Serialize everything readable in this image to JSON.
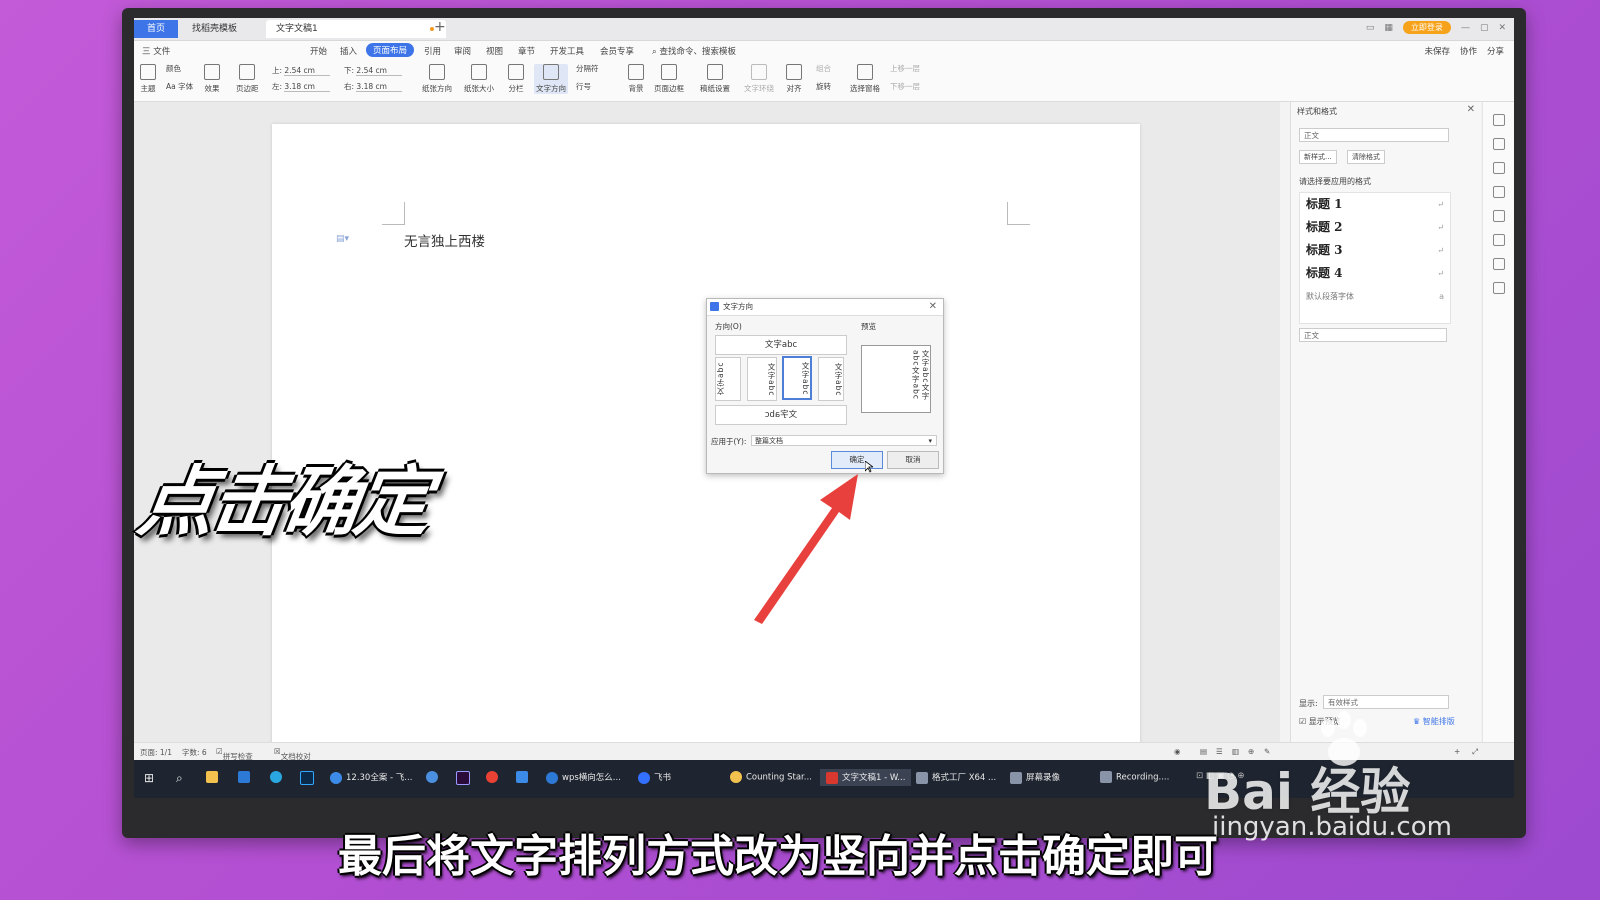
{
  "titlebar": {
    "tabs": [
      {
        "label": "首页"
      },
      {
        "label": "找稻壳模板"
      },
      {
        "label": "文字文稿1"
      }
    ],
    "new_tab": "+",
    "login": "立即登录"
  },
  "menubar": {
    "file": "三 文件",
    "items": [
      "开始",
      "插入",
      "页面布局",
      "引用",
      "审阅",
      "视图",
      "章节",
      "开发工具",
      "会员专享"
    ],
    "search": "查找命令、搜索模板",
    "unsaved": "未保存",
    "collab": "协作",
    "share": "分享"
  },
  "ribbon": {
    "theme": "主题",
    "colors": "颜色",
    "fonts": "Aa 字体",
    "effects": "效果",
    "margins": "页边距",
    "top_label": "上:",
    "top_val": "2.54 cm",
    "bottom_label": "下:",
    "bottom_val": "2.54 cm",
    "left_label": "左:",
    "left_val": "3.18 cm",
    "right_label": "右:",
    "right_val": "3.18 cm",
    "orientation": "纸张方向",
    "size": "纸张大小",
    "columns": "分栏",
    "text_dir": "文字方向",
    "breaks": "分隔符",
    "line_num": "行号",
    "background": "背景",
    "border": "页面边框",
    "paper_setup": "稿纸设置",
    "wrap": "文字环绕",
    "align": "对齐",
    "rotate": "旋转",
    "group": "组合",
    "select_pane": "选择窗格",
    "bring_fwd": "上移一层",
    "send_back": "下移一层"
  },
  "document": {
    "text": "无言独上西楼"
  },
  "dialog": {
    "title": "文字方向",
    "direction_label": "方向(O)",
    "preview_label": "预览",
    "opt_horizontal": "文字abc",
    "opt_v1": "文字abc",
    "opt_v2": "文字abc",
    "opt_v3": "文字abc",
    "opt_v4": "文字abc",
    "opt_rotated": "文字abc",
    "preview_text": "文字abc文字abc文字abc",
    "apply_label": "应用于(Y):",
    "apply_value": "整篇文档",
    "ok": "确定",
    "cancel": "取消"
  },
  "pane": {
    "title": "样式和格式",
    "current": "正文",
    "new_style": "新样式...",
    "clear_format": "清除格式",
    "choose_label": "请选择要应用的格式",
    "styles": [
      "标题 1",
      "标题 2",
      "标题 3",
      "标题 4"
    ],
    "default_font": "默认段落字体",
    "body": "正文",
    "show_label": "显示:",
    "show_value": "有效样式",
    "preview_check": "显示预览",
    "smart": "智能排版"
  },
  "statusbar": {
    "page": "页面: 1/1",
    "words": "字数: 6",
    "spell": "拼写检查",
    "proof": "文档校对"
  },
  "taskbar": {
    "items": [
      "12.30全案 - 飞...",
      "wps横向怎么...",
      "飞书",
      "Counting Star...",
      "文字文稿1 - W...",
      "格式工厂 X64 ...",
      "屏幕录像",
      "Recording...."
    ]
  },
  "overlay": {
    "big_caption": "点击确定",
    "subtitle": "最后将文字排列方式改为竖向并点击确定即可",
    "watermark": "Bai 经验",
    "watermark_url": "jingyan.baidu.com"
  },
  "colors": {
    "accent": "#3d74e8",
    "arrow": "#e8403c",
    "background": "#b954d4"
  }
}
